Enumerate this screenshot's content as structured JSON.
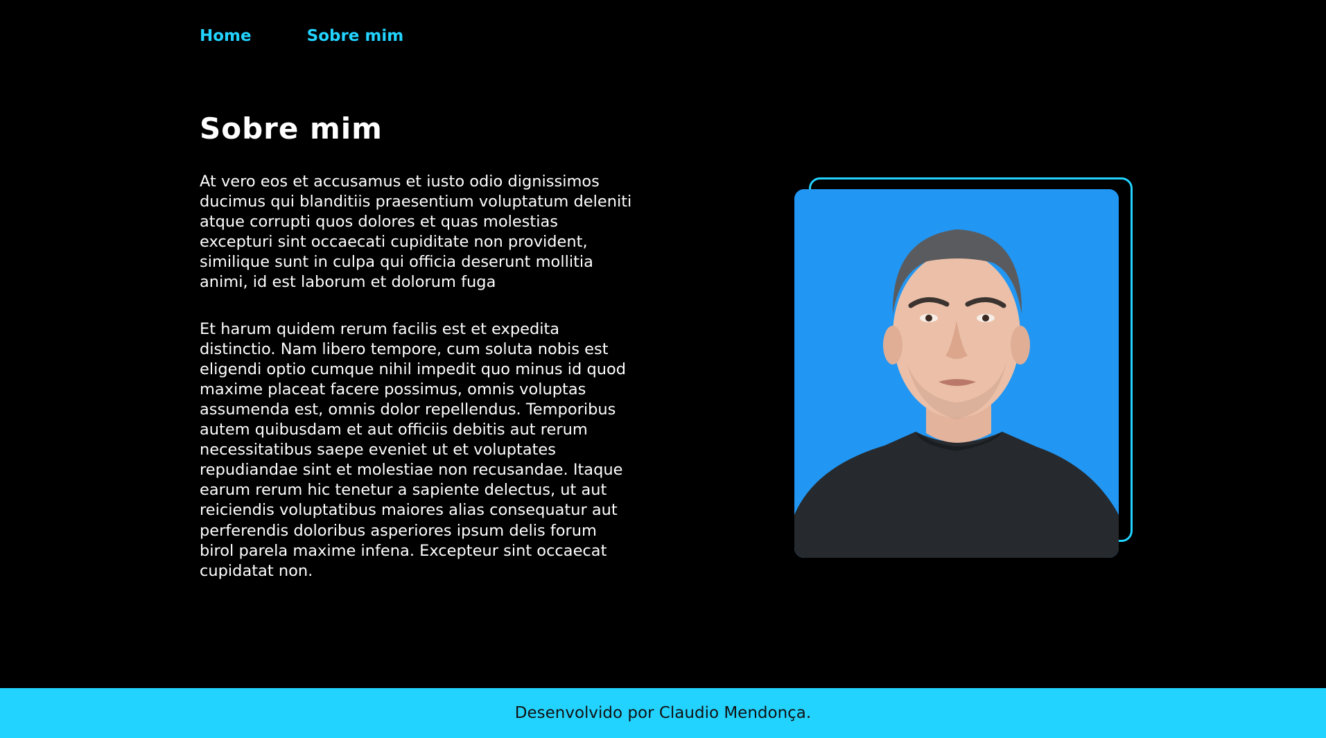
{
  "nav": {
    "items": [
      {
        "label": "Home"
      },
      {
        "label": "Sobre mim"
      }
    ]
  },
  "main": {
    "title": "Sobre mim",
    "paragraphs": [
      "At vero eos et accusamus et iusto odio dignissimos ducimus qui blanditiis praesentium voluptatum deleniti atque corrupti quos dolores et quas molestias excepturi sint occaecati cupiditate non provident, similique sunt in culpa qui officia deserunt mollitia animi, id est laborum et dolorum fuga",
      "Et harum quidem rerum facilis est et expedita distinctio. Nam libero tempore, cum soluta nobis est eligendi optio cumque nihil impedit quo minus id quod maxime placeat facere possimus, omnis voluptas assumenda est, omnis dolor repellendus. Temporibus autem quibusdam et aut officiis debitis aut rerum necessitatibus saepe eveniet ut et voluptates repudiandae sint et molestiae non recusandae. Itaque earum rerum hic tenetur a sapiente delectus, ut aut reiciendis voluptatibus maiores alias consequatur aut perferendis doloribus asperiores ipsum delis forum birol parela maxime infena. Excepteur sint occaecat cupidatat non."
    ]
  },
  "footer": {
    "text": "Desenvolvido por Claudio Mendonça."
  },
  "colors": {
    "background": "#000000",
    "accent": "#22d3ff",
    "photo_background": "#2196f3",
    "text": "#ffffff",
    "footer_text": "#111111"
  }
}
